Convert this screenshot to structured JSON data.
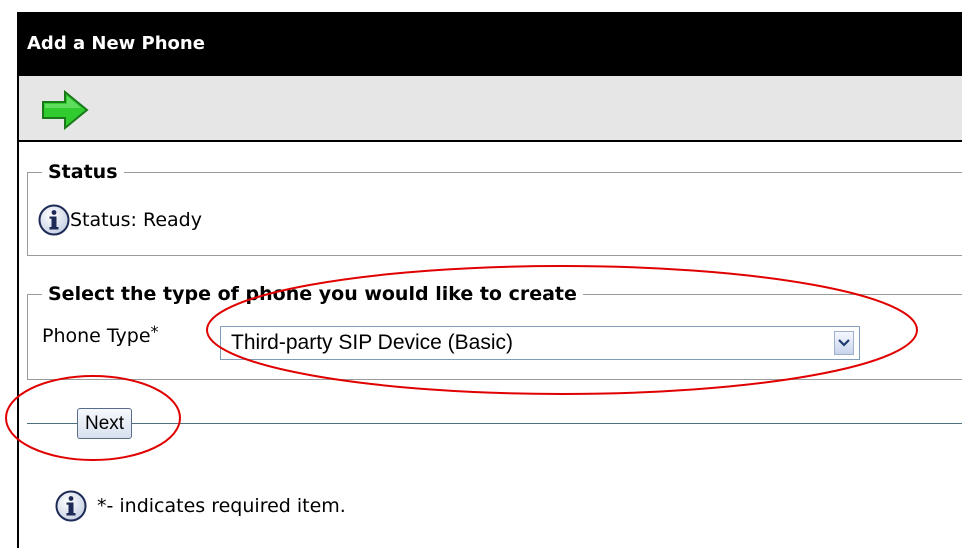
{
  "header": {
    "title": "Add a New Phone"
  },
  "toolbar": {
    "next_icon": "green-right-arrow-icon"
  },
  "status": {
    "legend": "Status",
    "icon": "info-icon",
    "text": "Status: Ready"
  },
  "phone_select": {
    "legend": "Select the type of phone you would like to create",
    "label": "Phone Type",
    "required_marker": "*",
    "selected_value": "Third-party SIP Device (Basic)"
  },
  "actions": {
    "next_label": "Next"
  },
  "note": {
    "text": "*- indicates required item."
  },
  "colors": {
    "header_bg": "#000000",
    "toolbar_bg": "#e6e6e6",
    "arrow_green": "#33cc33",
    "annotation_red": "#e00000"
  }
}
